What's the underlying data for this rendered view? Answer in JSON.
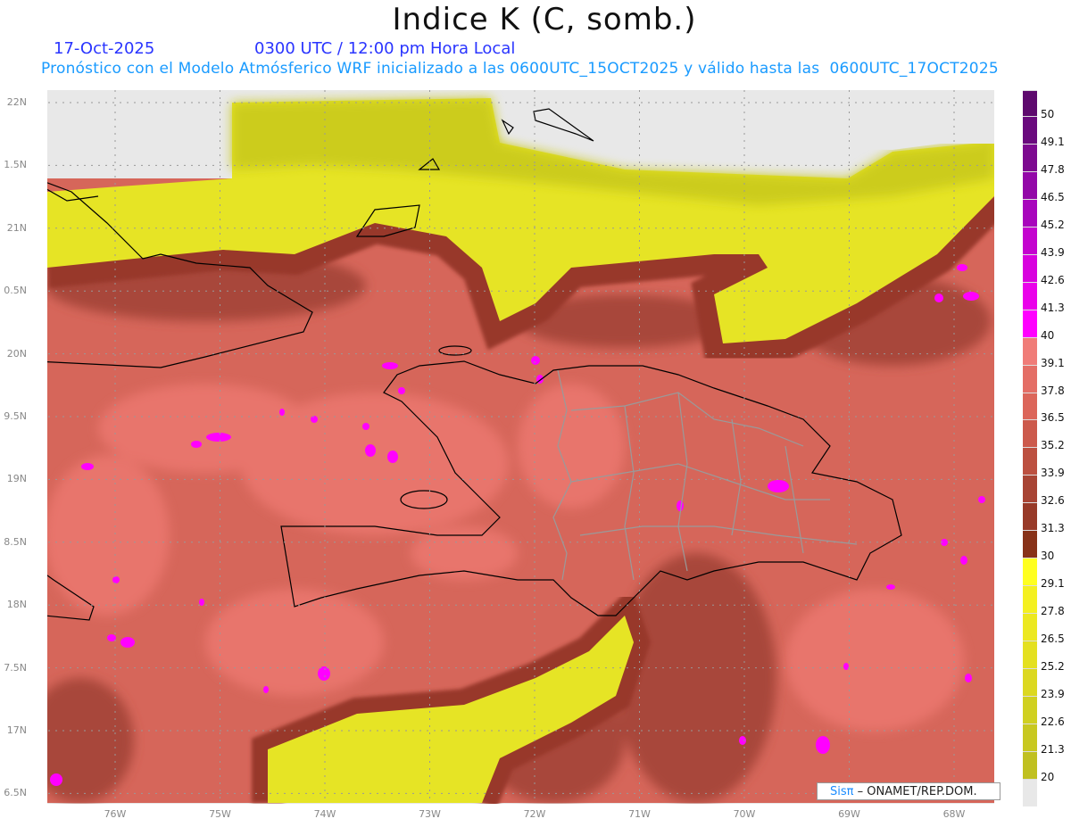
{
  "header": {
    "title": "Indice K (C, somb.)",
    "date": "17-Oct-2025",
    "time": "0300 UTC / 12:00 pm Hora Local",
    "subtitle": "Pronóstico con el Modelo Atmósferico WRF inicializado a las 0600UTC_15OCT2025 y válido hasta las  0600UTC_17OCT2025"
  },
  "axes": {
    "lat_labels": [
      "22N",
      "1.5N",
      "21N",
      "0.5N",
      "20N",
      "9.5N",
      "19N",
      "8.5N",
      "18N",
      "7.5N",
      "17N",
      "6.5N"
    ],
    "lon_labels": [
      "76W",
      "75W",
      "74W",
      "73W",
      "72W",
      "71W",
      "70W",
      "69W",
      "68W"
    ]
  },
  "colorbar": {
    "labels": [
      "50",
      "49.1",
      "47.8",
      "46.5",
      "45.2",
      "43.9",
      "42.6",
      "41.3",
      "40",
      "39.1",
      "37.8",
      "36.5",
      "35.2",
      "33.9",
      "32.6",
      "31.3",
      "30",
      "29.1",
      "27.8",
      "26.5",
      "25.2",
      "23.9",
      "22.6",
      "21.3",
      "20"
    ],
    "colors": [
      "#5e0a6e",
      "#6a0a7e",
      "#7d0a90",
      "#9308a8",
      "#a806bc",
      "#c404cf",
      "#d802de",
      "#ea02ea",
      "#ff00ff",
      "#f07c78",
      "#e46e66",
      "#dc665a",
      "#cc5a4c",
      "#bc5040",
      "#a84434",
      "#983a28",
      "#883218",
      "#ffff20",
      "#f4f020",
      "#ece820",
      "#e4e020",
      "#dcd820",
      "#d0d020",
      "#c8c820",
      "#c0c020",
      "#e8e8e8"
    ]
  },
  "credit": {
    "brand": "Sisπ",
    "text": " –  ONAMET/REP.DOM."
  },
  "colors": {
    "land_gray": "#e8e8e8",
    "yellow": "#e6e425",
    "olive": "#cccc1c",
    "brown": "#98392a",
    "salmon": "#d6665a",
    "pink": "#e8756c",
    "magenta": "#ff00ff"
  }
}
